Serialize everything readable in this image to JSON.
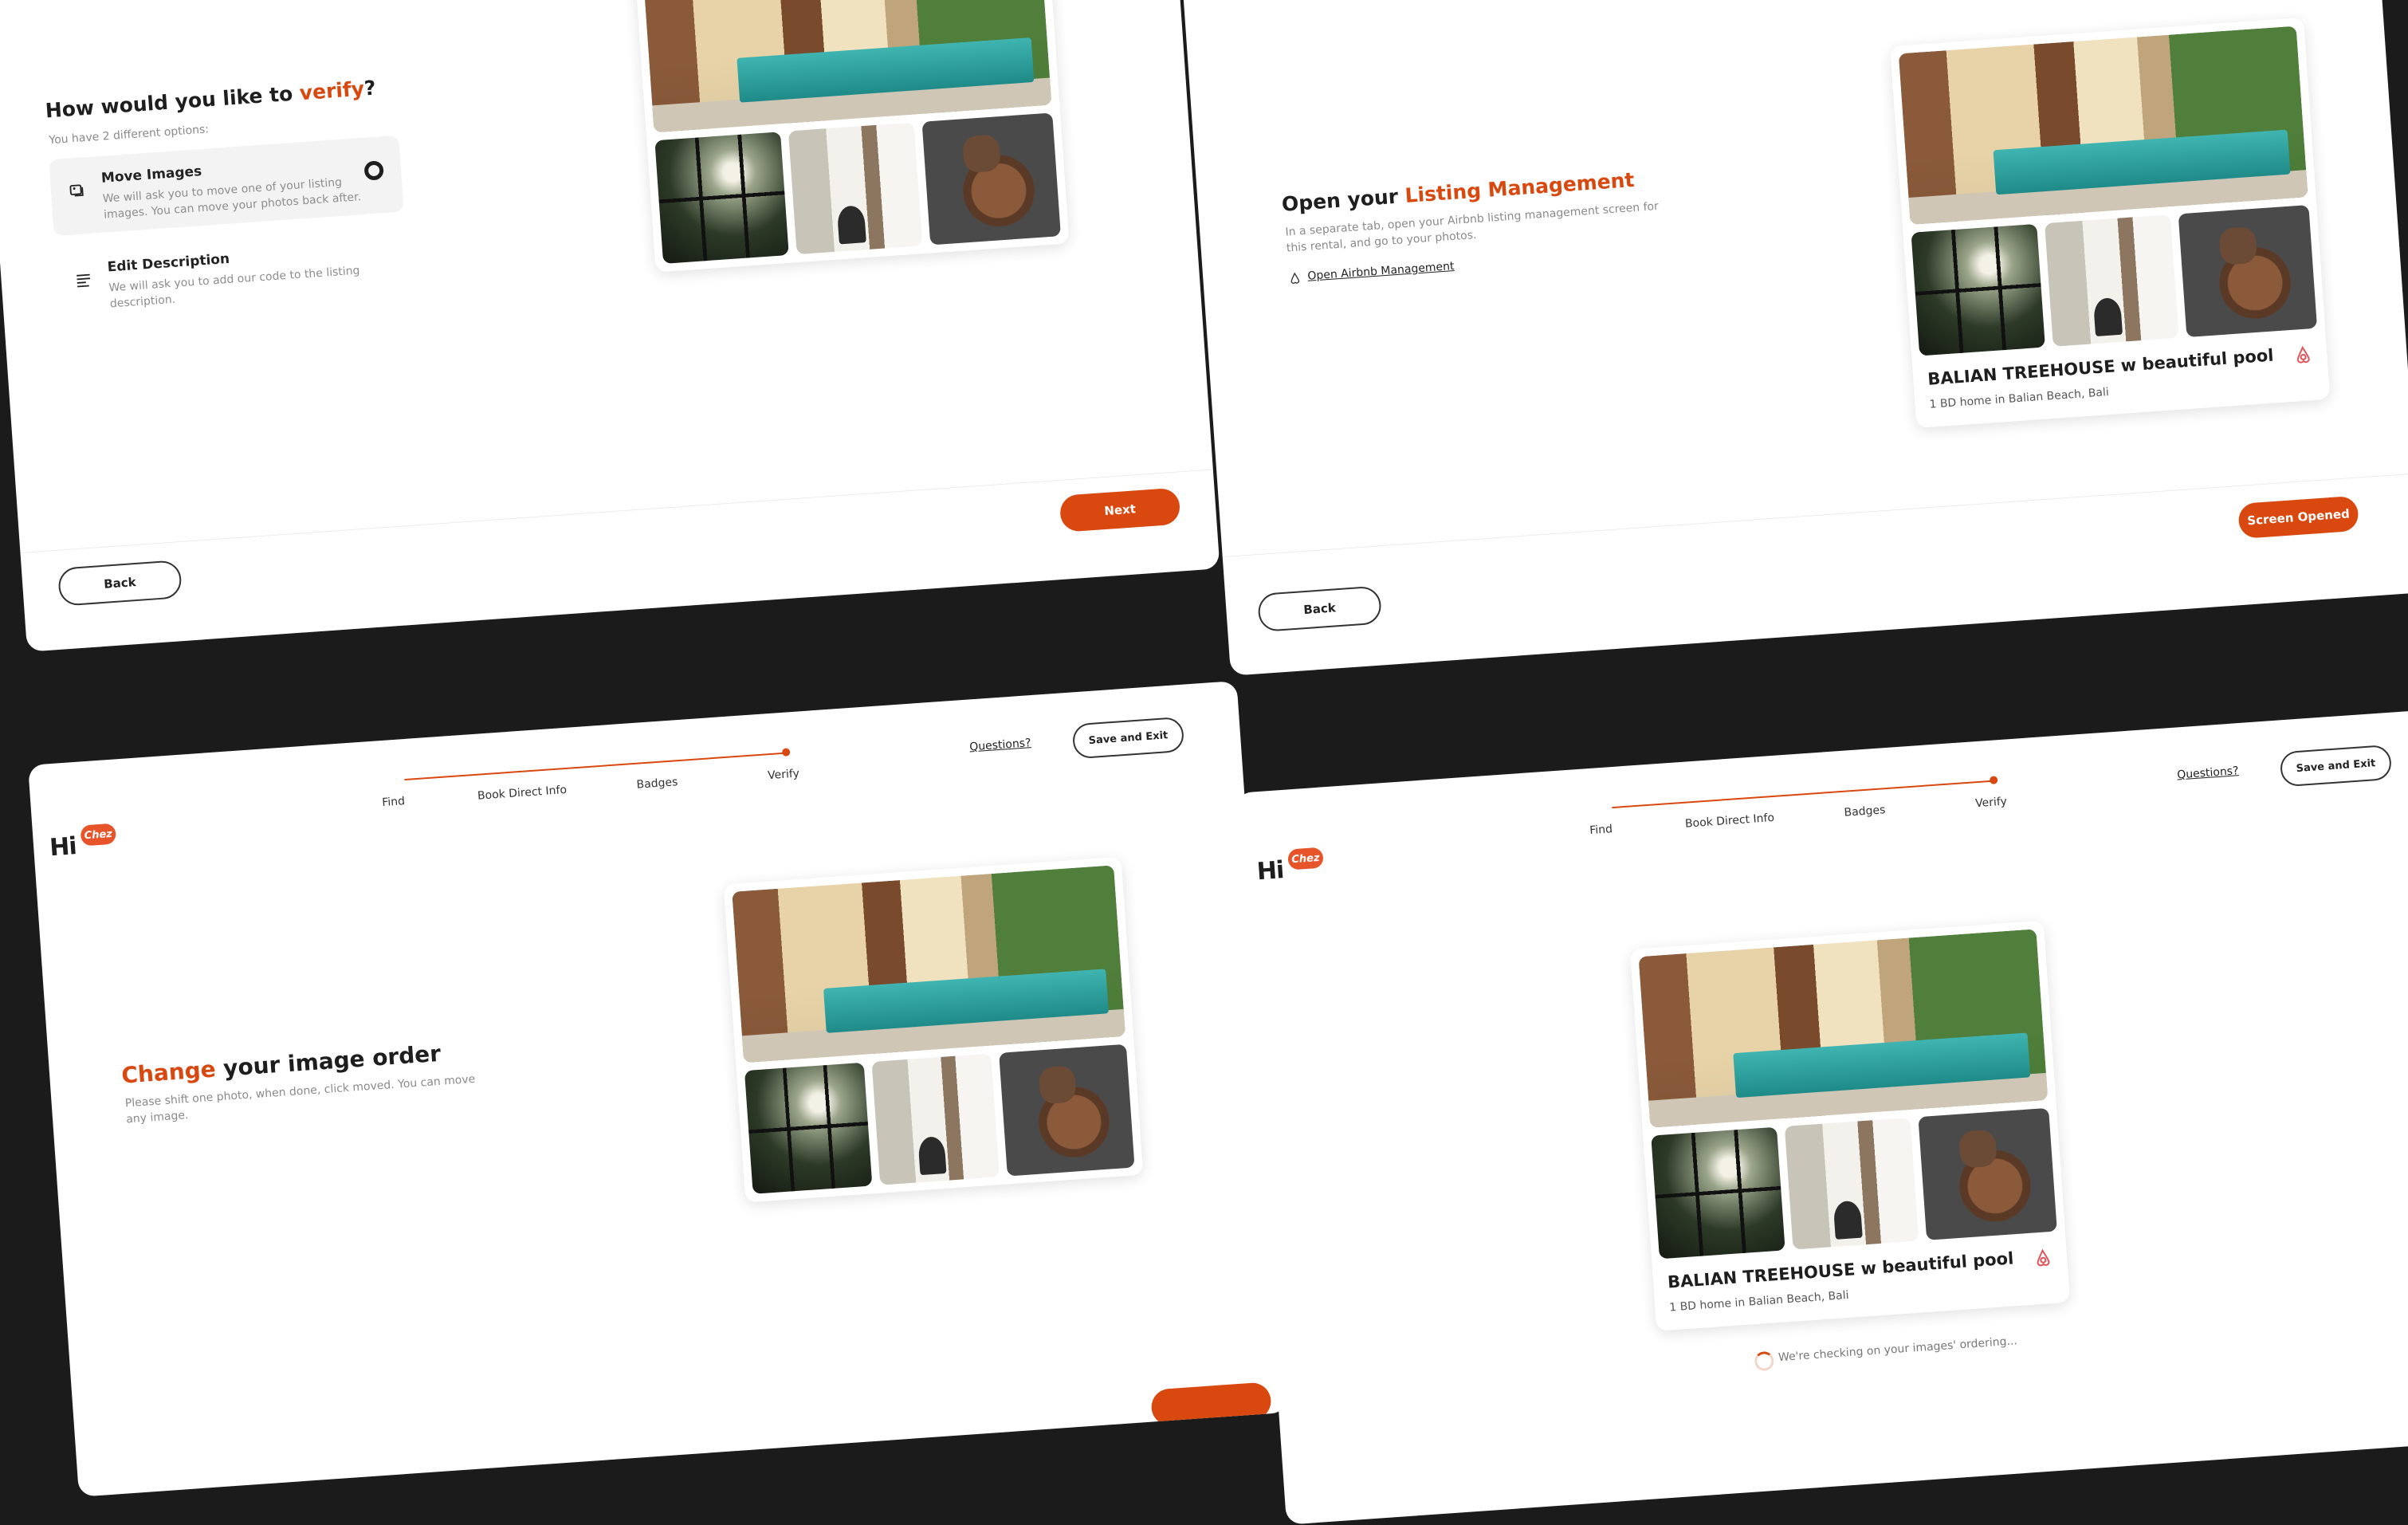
{
  "colors": {
    "accent": "#d9480f",
    "background": "#1b1b1b"
  },
  "logo": {
    "text": "Hi",
    "badge": "Chez"
  },
  "progress": {
    "steps": [
      "Find",
      "Book Direct Info",
      "Badges",
      "Verify"
    ],
    "current_step": 4
  },
  "header": {
    "questions": "Questions?",
    "save_exit": "Save and Exit"
  },
  "listing": {
    "name": "BALIAN TREEHOUSE w beautiful pool",
    "subtitle": "1 BD home in Balian Beach, Bali"
  },
  "verify_screen": {
    "title_prefix": "How would you like to ",
    "title_accent": "verify",
    "title_suffix": "?",
    "subtitle": "You have 2 different options:",
    "options": [
      {
        "title": "Move Images",
        "desc": "We will ask you to move one of your listing images. You can move your photos back after.",
        "icon": "image-move-icon",
        "selected": true
      },
      {
        "title": "Edit Description",
        "desc": "We will ask you to add our code to the listing description.",
        "icon": "text-lines-icon",
        "selected": false
      }
    ],
    "next": "Next",
    "back": "Back"
  },
  "listing_screen": {
    "title_prefix": "Open your ",
    "title_accent": "Listing Management",
    "subtitle": "In a separate tab, open your Airbnb listing management screen for this rental, and go to your photos.",
    "link": "Open Airbnb Management",
    "confirm": "Screen Opened",
    "back": "Back"
  },
  "order_screen": {
    "title_accent": "Change",
    "title_suffix": " your image order",
    "subtitle": "Please shift one photo, when done, click moved. You can move any image."
  },
  "checking_screen": {
    "status": "We're checking on your images' ordering..."
  }
}
